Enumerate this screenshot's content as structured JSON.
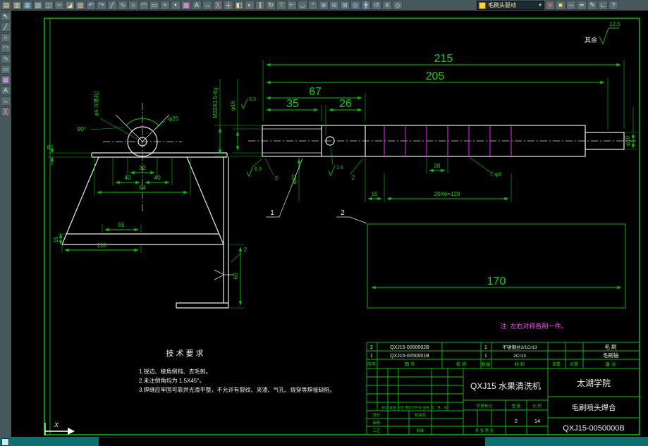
{
  "toolbar": {
    "combo": {
      "label": "毛刷头驱动",
      "arrow": "▼"
    },
    "top_icons": [
      {
        "name": "new-file",
        "glyph": "▤",
        "color": "#ffec9e"
      },
      {
        "name": "open-file",
        "glyph": "▥",
        "color": "#ffec9e"
      },
      {
        "name": "save-file",
        "glyph": "▦",
        "color": "#9ecfff"
      },
      {
        "name": "plot",
        "glyph": "▧",
        "color": "#d8d8d8"
      },
      {
        "name": "print-preview",
        "glyph": "◫",
        "color": "#d8d8d8"
      },
      {
        "name": "cut",
        "glyph": "✂",
        "color": "#ff9e9e"
      },
      {
        "name": "copy",
        "glyph": "◪",
        "color": "#ffd49e"
      },
      {
        "name": "paste",
        "glyph": "▨",
        "color": "#ffd49e"
      },
      {
        "name": "undo",
        "glyph": "↶",
        "color": "#9ecfff"
      },
      {
        "name": "redo",
        "glyph": "↷",
        "color": "#9ecfff"
      },
      {
        "name": "draw-line",
        "glyph": "╱",
        "color": "#9effa8"
      },
      {
        "name": "draw-polyline",
        "glyph": "∿",
        "color": "#9effa8"
      },
      {
        "name": "draw-circle",
        "glyph": "○",
        "color": "#fff29e"
      },
      {
        "name": "draw-arc",
        "glyph": "◠",
        "color": "#fff29e"
      },
      {
        "name": "draw-rectangle",
        "glyph": "▭",
        "color": "#9effa8"
      },
      {
        "name": "draw-spline",
        "glyph": "≈",
        "color": "#9effa8"
      },
      {
        "name": "draw-point",
        "glyph": "•",
        "color": "#ffffff"
      },
      {
        "name": "hatch",
        "glyph": "▩",
        "color": "#ff9eff"
      },
      {
        "name": "text-tool",
        "glyph": "A",
        "color": "#9effd4"
      },
      {
        "name": "dimension-linear",
        "glyph": "↔",
        "color": "#9effd4"
      },
      {
        "name": "erase",
        "glyph": "╳",
        "color": "#ff9e9e"
      },
      {
        "name": "move",
        "glyph": "┼",
        "color": "#ffd49e"
      },
      {
        "name": "copy-object",
        "glyph": "◧",
        "color": "#ffd49e"
      },
      {
        "name": "mirror",
        "glyph": "◐",
        "color": "#ffd49e"
      },
      {
        "name": "offset",
        "glyph": "∥",
        "color": "#ffd49e"
      },
      {
        "name": "rotate",
        "glyph": "↻",
        "color": "#ffd49e"
      },
      {
        "name": "trim",
        "glyph": "⊤",
        "color": "#ff9e9e"
      },
      {
        "name": "extend",
        "glyph": "⊢",
        "color": "#9effa8"
      },
      {
        "name": "fillet",
        "glyph": "◡",
        "color": "#9effa8"
      },
      {
        "name": "explode",
        "glyph": "*",
        "color": "#ff9e9e"
      },
      {
        "name": "zoom-in",
        "glyph": "⊕",
        "color": "#9ecfff"
      },
      {
        "name": "zoom-out",
        "glyph": "⊖",
        "color": "#9ecfff"
      },
      {
        "name": "zoom-window",
        "glyph": "⊞",
        "color": "#9ecfff"
      },
      {
        "name": "zoom-all",
        "glyph": "◎",
        "color": "#9ecfff"
      },
      {
        "name": "pan",
        "glyph": "╋",
        "color": "#9ecfff"
      },
      {
        "name": "redraw",
        "glyph": "↺",
        "color": "#9ecfff"
      },
      {
        "name": "layer-manager",
        "glyph": "≡",
        "color": "#fff29e"
      },
      {
        "name": "object-snap",
        "glyph": "◇",
        "color": "#fff29e"
      }
    ],
    "right_icons": [
      {
        "name": "color-control",
        "glyph": "■",
        "color": "#ff5050"
      },
      {
        "name": "layer-control",
        "glyph": "■",
        "color": "#ffe050"
      },
      {
        "name": "linetype-control",
        "glyph": "─",
        "color": "#d8d8d8"
      },
      {
        "name": "lineweight-control",
        "glyph": "━",
        "color": "#d8d8d8"
      },
      {
        "name": "match-properties",
        "glyph": "✎",
        "color": "#9effd4"
      },
      {
        "name": "ortho-mode",
        "glyph": "∟",
        "color": "#ffffff"
      },
      {
        "name": "help",
        "glyph": "?",
        "color": "#9ecfff"
      }
    ],
    "left_icons": [
      {
        "name": "select",
        "glyph": "↖",
        "color": "#ffffff"
      },
      {
        "name": "line-tool",
        "glyph": "╱",
        "color": "#9effa8"
      },
      {
        "name": "circle-tool",
        "glyph": "○",
        "color": "#fff29e"
      },
      {
        "name": "arc-tool",
        "glyph": "◠",
        "color": "#fff29e"
      },
      {
        "name": "polyline-tool",
        "glyph": "∿",
        "color": "#9effa8"
      },
      {
        "name": "rectangle-tool",
        "glyph": "▭",
        "color": "#9effa8"
      },
      {
        "name": "hatch-tool",
        "glyph": "▩",
        "color": "#ff9eff"
      },
      {
        "name": "text-tool",
        "glyph": "A",
        "color": "#9effd4"
      },
      {
        "name": "dimension-tool",
        "glyph": "↔",
        "color": "#9effd4"
      },
      {
        "name": "erase-tool",
        "glyph": "╳",
        "color": "#ff9e9e"
      }
    ]
  },
  "drawing": {
    "surface_default": {
      "label": "其余",
      "value": "12.5"
    },
    "balloons": {
      "b1": "1",
      "b2": "2"
    },
    "note": "注: 左右对称各制一件。",
    "ucs_x": "X",
    "tech": {
      "title": "技 术 要 求",
      "items": [
        "1.锐边、棱角倒钝、去毛刺。",
        "2.未注倒角均为 1.5X45°。",
        "3.焊缝应牢固可靠并光滑平整，不允许有裂纹、夹渣、气孔、烧穿等焊接缺陷。"
      ]
    },
    "shaft": {
      "d215": "215",
      "d205": "205",
      "d67": "67",
      "d35": "35",
      "d26": "26",
      "thread": "M22X1.5-6g",
      "dia16": "φ16",
      "ra63a": "6.3",
      "ra63b": "6.3",
      "ra16": "1.6",
      "cham2a": "2",
      "cham2b": "2",
      "dia22": "φ22",
      "d20": "20",
      "holes": "7-φ4",
      "d15": "15",
      "pattern": "20X6=120",
      "d170": "170",
      "dia10": "φ10"
    },
    "bracket": {
      "t8": "8",
      "hole": "φ6.7(通孔)",
      "angle": "90°",
      "dia25": "φ25",
      "d32": "32",
      "d40a": "40",
      "d40b": "40",
      "d64": "64",
      "d15": "15",
      "d55": "55",
      "d110": "110",
      "d60": "60",
      "weld2": "2"
    }
  },
  "titleblock": {
    "bom": {
      "headers": {
        "no": "序号",
        "code": "图  号",
        "name": "名  称",
        "qty": "数量",
        "material": "材  料",
        "unit": "单重",
        "total": "总重",
        "note": "备 注"
      },
      "rows": [
        {
          "no": "2",
          "code": "QXJ15-0050002B",
          "qty": "1",
          "material": "不锈钢丝2/1Cr13",
          "part": "毛 刷"
        },
        {
          "no": "1",
          "code": "QXJ15-0050001B",
          "qty": "1",
          "material": "2Cr13",
          "part": "毛刷轴"
        }
      ]
    },
    "product": "QXJ15 水果清洗机",
    "company": "太湖学院",
    "part_name": "毛刷喷头焊合",
    "dwg_no": "QXJ15-0050000B",
    "weight": "2",
    "scale": "14",
    "small": {
      "rev": "标记 处数 分区 更改文件号 签名 年、月、日",
      "design": "设计",
      "standard": "标准化",
      "audit": "审核",
      "process": "工艺",
      "approve": "批准",
      "stage": "阶段标记",
      "weight_lbl": "重 量",
      "scale_lbl": "比 例",
      "sheet_strip": "共 张 第 张"
    }
  }
}
